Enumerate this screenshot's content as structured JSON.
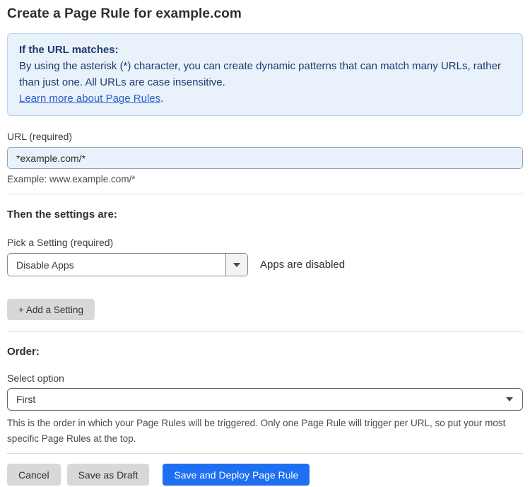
{
  "page": {
    "title": "Create a Page Rule for example.com"
  },
  "info_box": {
    "heading": "If the URL matches:",
    "body": "By using the asterisk (*) character, you can create dynamic patterns that can match many URLs, rather than just one. All URLs are case insensitive.",
    "link_label": "Learn more about Page Rules",
    "link_suffix": "."
  },
  "url_field": {
    "label": "URL (required)",
    "value": "*example.com/*",
    "example": "Example: www.example.com/*"
  },
  "settings": {
    "heading": "Then the settings are:",
    "pick_label": "Pick a Setting (required)",
    "selected_option": "Disable Apps",
    "status_text": "Apps are disabled",
    "add_button_label": "+ Add a Setting"
  },
  "order": {
    "heading": "Order:",
    "label": "Select option",
    "selected_option": "First",
    "help_text": "This is the order in which your Page Rules will be triggered. Only one Page Rule will trigger per URL, so put your most specific Page Rules at the top."
  },
  "footer": {
    "cancel_label": "Cancel",
    "save_draft_label": "Save as Draft",
    "save_deploy_label": "Save and Deploy Page Rule"
  },
  "colors": {
    "primary_button": "#1f6ff2",
    "info_box_bg": "#e9f1fb",
    "info_box_border": "#b7d2ef",
    "info_box_text": "#1e3a6e",
    "link": "#2b5fc7",
    "url_input_bg": "#e9f1fc",
    "gray_button_bg": "#d8d8d8"
  }
}
